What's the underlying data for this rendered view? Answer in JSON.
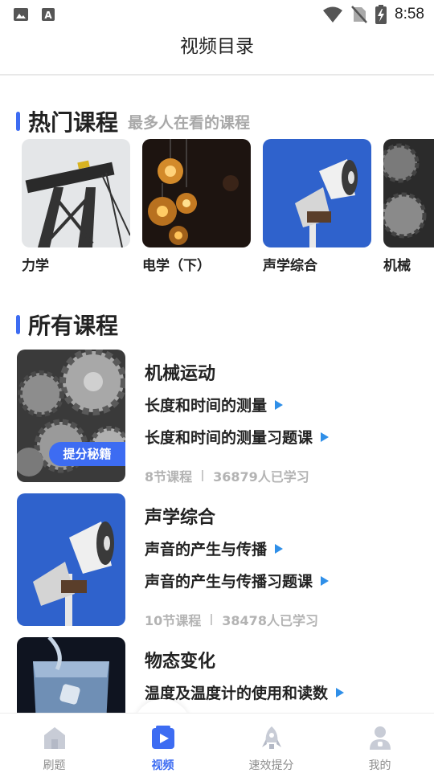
{
  "status_bar": {
    "time": "8:58"
  },
  "header": {
    "title": "视频目录"
  },
  "hot_section": {
    "title": "热门课程",
    "subtitle": "最多人在看的课程",
    "items": [
      {
        "label": "力学"
      },
      {
        "label": "电学（下）"
      },
      {
        "label": "声学综合"
      },
      {
        "label": "机械"
      }
    ]
  },
  "all_section": {
    "title": "所有课程",
    "courses": [
      {
        "title": "机械运动",
        "lessons": [
          "长度和时间的测量",
          "长度和时间的测量习题课"
        ],
        "count": "8节课程",
        "learners": "36879人已学习",
        "badge": "提分秘籍"
      },
      {
        "title": "声学综合",
        "lessons": [
          "声音的产生与传播",
          "声音的产生与传播习题课"
        ],
        "count": "10节课程",
        "learners": "38478人已学习"
      },
      {
        "title": "物态变化",
        "lessons": [
          "温度及温度计的使用和读数"
        ]
      }
    ]
  },
  "tabs": [
    {
      "label": "刷题",
      "icon": "home-icon"
    },
    {
      "label": "视频",
      "icon": "video-icon",
      "active": true
    },
    {
      "label": "速效提分",
      "icon": "rocket-icon"
    },
    {
      "label": "我的",
      "icon": "person-icon"
    }
  ],
  "colors": {
    "accent": "#3d6cf2",
    "play_triangle": "#2f8fe8",
    "meta_text": "#b3b3b3"
  }
}
